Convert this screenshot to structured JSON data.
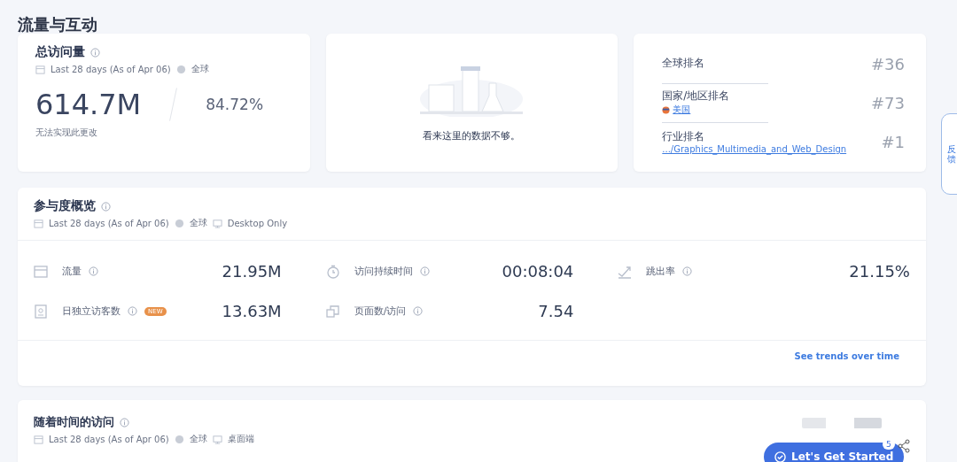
{
  "section_title": "流量与互动",
  "total_visits": {
    "title": "总访问量",
    "period": "Last 28 days (As of Apr 06)",
    "region": "全球",
    "value": "614.7M",
    "share": "84.72%",
    "note": "无法实现此更改"
  },
  "empty_state": {
    "message": "看来这里的数据不够。"
  },
  "rankings": [
    {
      "label": "全球排名",
      "rank": "#36"
    },
    {
      "label": "国家/地区排名",
      "link": "美国",
      "rank": "#73"
    },
    {
      "label": "行业排名",
      "link": ".../Graphics_Multimedia_and_Web_Design",
      "rank": "#1"
    }
  ],
  "engagement": {
    "title": "参与度概览",
    "period": "Last 28 days (As of Apr 06)",
    "region": "全球",
    "device": "Desktop Only",
    "metrics": [
      {
        "kind": "visits",
        "label": "流量",
        "value": "21.95M"
      },
      {
        "kind": "duration",
        "label": "访问持续时间",
        "value": "00:08:04"
      },
      {
        "kind": "bounce",
        "label": "跳出率",
        "value": "21.15%"
      },
      {
        "kind": "unique",
        "label": "日独立访客数",
        "badge": "NEW",
        "value": "13.63M"
      },
      {
        "kind": "pages",
        "label": "页面数/访问",
        "value": "7.54"
      }
    ],
    "link": "See trends over time"
  },
  "visits_over_time": {
    "title": "随着时间的访问",
    "period": "Last 28 days (As of Apr 06)",
    "region": "全球",
    "device": "桌面端"
  },
  "feedback_tab": "反馈",
  "get_started": {
    "label": "Let's Get Started",
    "count": "5"
  }
}
